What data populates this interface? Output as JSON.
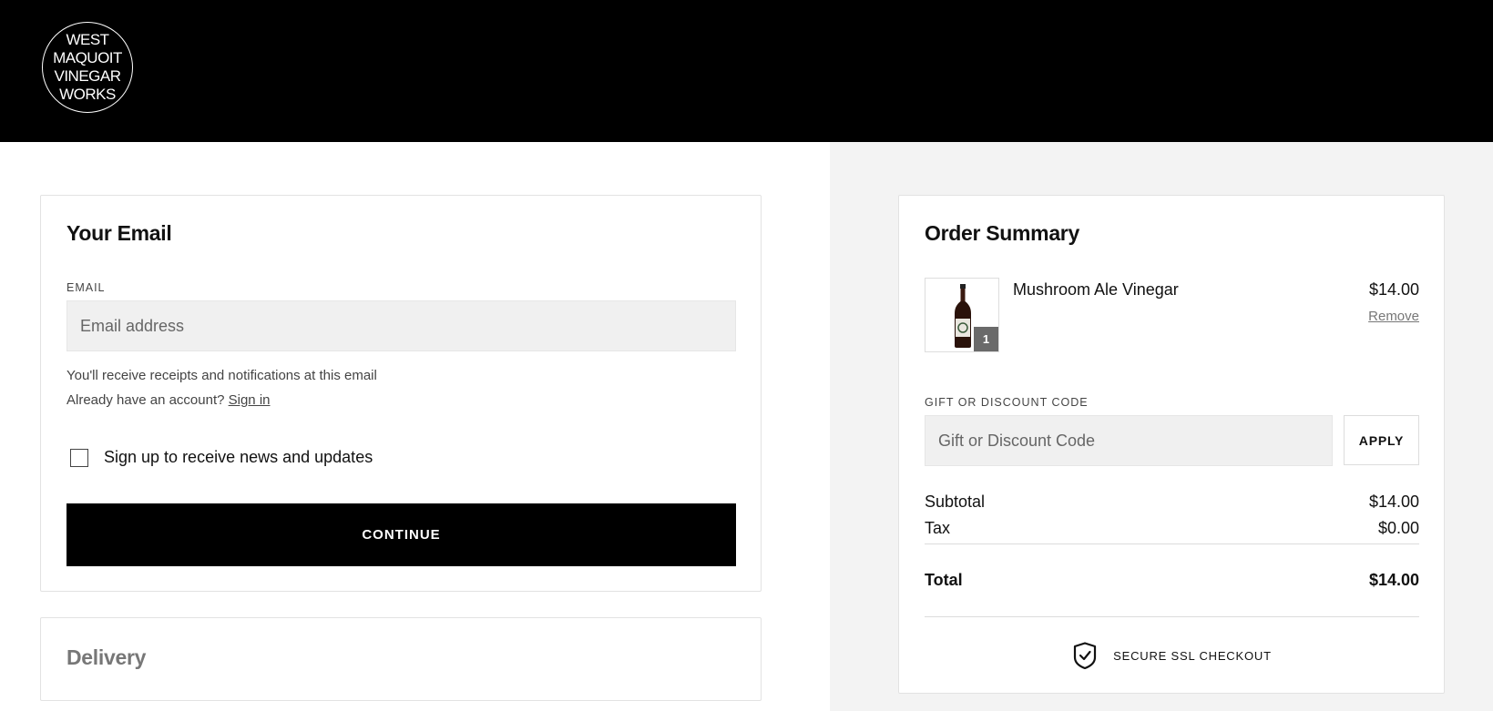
{
  "brand": {
    "logo_lines": [
      "WEST",
      "MAQUOIT",
      "VINEGAR",
      "WORKS"
    ]
  },
  "email_section": {
    "title": "Your Email",
    "email_label": "EMAIL",
    "email_placeholder": "Email address",
    "email_value": "",
    "receipt_hint": "You'll receive receipts and notifications at this email",
    "account_prompt": "Already have an account?",
    "sign_in_link": "Sign in",
    "newsletter_label": "Sign up to receive news and updates",
    "newsletter_checked": false,
    "continue_label": "CONTINUE"
  },
  "delivery_section": {
    "title": "Delivery"
  },
  "order_summary": {
    "title": "Order Summary",
    "items": [
      {
        "name": "Mushroom Ale Vinegar",
        "price": "$14.00",
        "quantity": "1",
        "remove_label": "Remove"
      }
    ],
    "discount_label": "GIFT OR DISCOUNT CODE",
    "discount_placeholder": "Gift or Discount Code",
    "apply_label": "APPLY",
    "subtotal_label": "Subtotal",
    "subtotal_value": "$14.00",
    "tax_label": "Tax",
    "tax_value": "$0.00",
    "total_label": "Total",
    "total_value": "$14.00",
    "secure_label": "SECURE SSL CHECKOUT"
  },
  "colors": {
    "header_bg": "#000000",
    "button_bg": "#000000",
    "sidebar_bg": "#f3f3f3"
  }
}
